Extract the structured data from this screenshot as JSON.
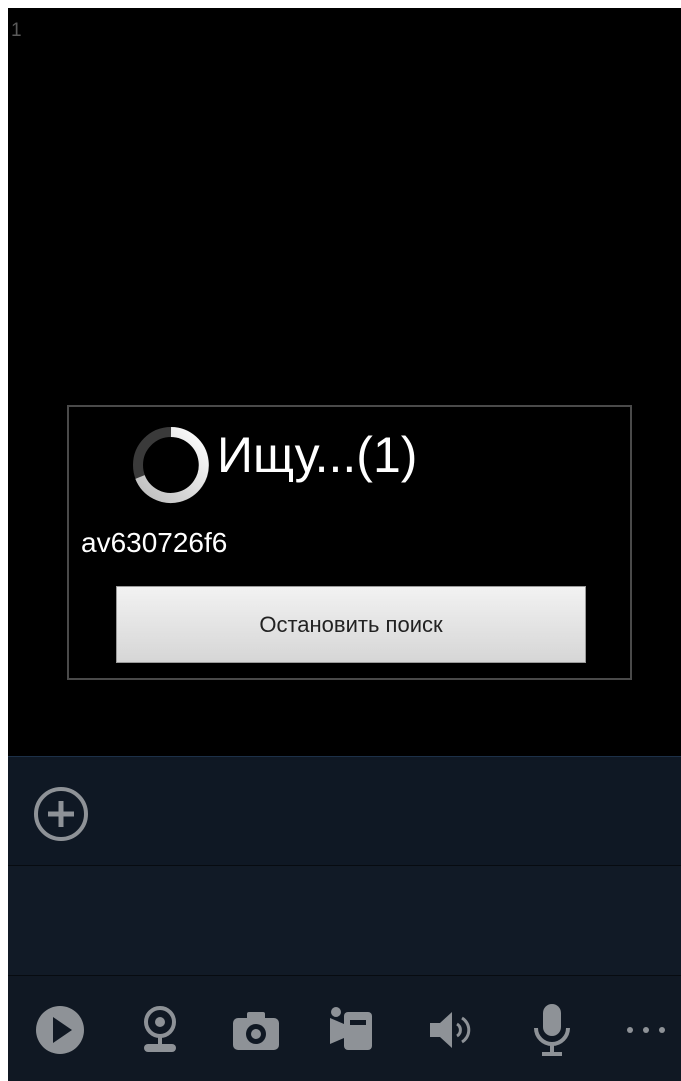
{
  "video": {
    "channel_number": "1"
  },
  "search_dialog": {
    "title": "Ищу...(1)",
    "device_id": "av630726f6",
    "stop_button_label": "Остановить поиск"
  },
  "add_bar": {
    "add_icon": "plus-circle-icon"
  },
  "toolbar": {
    "items": [
      {
        "icon": "play-icon"
      },
      {
        "icon": "webcam-icon"
      },
      {
        "icon": "camera-icon"
      },
      {
        "icon": "video-camera-icon"
      },
      {
        "icon": "speaker-icon"
      },
      {
        "icon": "microphone-icon"
      },
      {
        "icon": "more-icon"
      }
    ]
  },
  "colors": {
    "icon": "#8e9297",
    "panel": "#0f1824",
    "button_text": "#222222"
  }
}
